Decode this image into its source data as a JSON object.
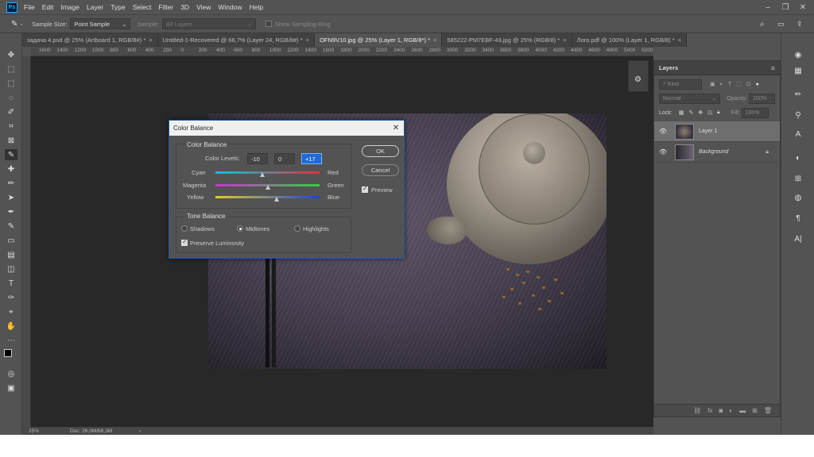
{
  "app": {
    "logo": "Ps"
  },
  "menu": [
    "File",
    "Edit",
    "Image",
    "Layer",
    "Type",
    "Select",
    "Filter",
    "3D",
    "View",
    "Window",
    "Help"
  ],
  "options": {
    "sample_size_label": "Sample Size:",
    "sample_size_value": "Point Sample",
    "sample_label": "Sample:",
    "sample_value": "All Layers",
    "sampling_ring_label": "Show Sampling Ring"
  },
  "tabs": [
    {
      "label": "задача 4.psd @ 25% (Artboard 1, RGB/8#) *",
      "active": false
    },
    {
      "label": "Untitled-1-Recovered @ 66,7% (Layer 24, RGB/8#) *",
      "active": false
    },
    {
      "label": "OFN9V10.jpg @ 25% (Layer 1, RGB/8*) *",
      "active": true
    },
    {
      "label": "585222-PM7EBF-43.jpg @ 25% (RGB/8) *",
      "active": false
    },
    {
      "label": "Лого.pdf @ 100% (Layer 1, RGB/8) *",
      "active": false
    }
  ],
  "ruler": [
    "1600",
    "1400",
    "1200",
    "1000",
    "800",
    "600",
    "400",
    "200",
    "0",
    "200",
    "400",
    "600",
    "800",
    "1000",
    "1200",
    "1400",
    "1600",
    "1800",
    "2000",
    "2200",
    "2400",
    "2600",
    "2800",
    "3000",
    "3200",
    "3400",
    "3600",
    "3800",
    "4000",
    "4200",
    "4400",
    "4600",
    "4800",
    "5000",
    "5200"
  ],
  "status": {
    "zoom": "25%",
    "doc": "Doc: 26,0M/68,3M"
  },
  "layers": {
    "tab": "Layers",
    "kind": "Kind",
    "blend": "Normal",
    "opacity_label": "Opacity:",
    "opacity": "100%",
    "lock_label": "Lock:",
    "fill_label": "Fill:",
    "fill": "100%",
    "items": [
      {
        "name": "Layer 1",
        "selected": true
      },
      {
        "name": "Background",
        "selected": false
      }
    ]
  },
  "dialog": {
    "title": "Color Balance",
    "group1": "Color Balance",
    "levels_label": "Color Levels:",
    "levels": [
      "-10",
      "0",
      "+17"
    ],
    "sliders": [
      {
        "left": "Cyan",
        "right": "Red",
        "value": -10
      },
      {
        "left": "Magenta",
        "right": "Green",
        "value": 0
      },
      {
        "left": "Yellow",
        "right": "Blue",
        "value": 17
      }
    ],
    "group2": "Tone Balance",
    "tones": [
      "Shadows",
      "Midtones",
      "Highlights"
    ],
    "tone_selected": "Midtones",
    "preserve": "Preserve Luminosity",
    "ok": "OK",
    "cancel": "Cancel",
    "preview": "Preview"
  }
}
